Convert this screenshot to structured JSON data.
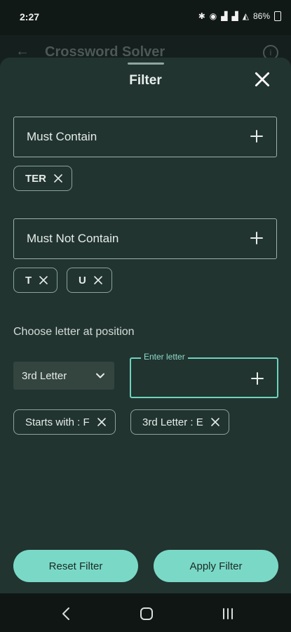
{
  "status_bar": {
    "time": "2:27",
    "battery": "86%"
  },
  "app_bar": {
    "title": "Crossword Solver"
  },
  "sheet": {
    "title": "Filter",
    "must_contain": {
      "label": "Must Contain",
      "chips": [
        "TER"
      ]
    },
    "must_not_contain": {
      "label": "Must Not Contain",
      "chips": [
        "T",
        "U"
      ]
    },
    "position": {
      "section_label": "Choose letter at position",
      "selected": "3rd Letter",
      "input_label": "Enter letter",
      "input_value": ""
    },
    "active_filters": [
      "Starts with : F",
      "3rd Letter : E"
    ],
    "reset_label": "Reset Filter",
    "apply_label": "Apply Filter"
  },
  "colors": {
    "sheet_bg": "#213430",
    "accent": "#7ad9c6",
    "outline": "#9db1ab"
  }
}
